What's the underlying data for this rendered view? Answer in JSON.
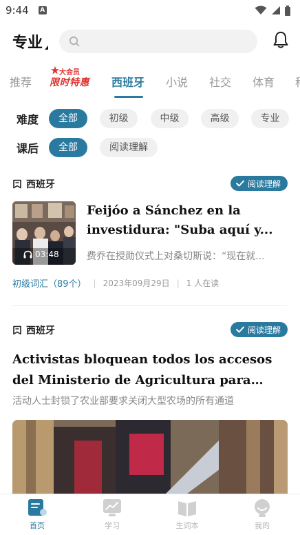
{
  "status_bar": {
    "time": "9:44",
    "notif": "A"
  },
  "header": {
    "level": "专业",
    "search_placeholder": ""
  },
  "tabs": {
    "items": [
      "推荐",
      "西班牙",
      "小说",
      "社交",
      "体育",
      "科"
    ],
    "active": "西班牙",
    "promo": {
      "top": "大会员",
      "main": "限时特惠"
    }
  },
  "filters": {
    "difficulty": {
      "label": "难度",
      "options": [
        "全部",
        "初级",
        "中级",
        "高级",
        "专业"
      ],
      "selected": "全部"
    },
    "after_class": {
      "label": "课后",
      "options": [
        "全部",
        "阅读理解"
      ],
      "selected": "全部"
    }
  },
  "articles": [
    {
      "category": "西班牙",
      "type": "阅读理解",
      "title": "Feijóo a Sánchez en la investidura: \"Suba aquí y...",
      "subtitle": "费乔在授勋仪式上对桑切斯说：“现在就...",
      "duration": "03:48",
      "vocab": "初级词汇（89个）",
      "date": "2023年09月29日",
      "readers": "1 人在读"
    },
    {
      "category": "西班牙",
      "type": "阅读理解",
      "title": "Activistas bloquean todos los accesos del Ministerio de Agricultura para exigir el...",
      "subtitle": "活动人士封锁了农业部要求关闭大型农场的所有通道"
    }
  ],
  "bottom_nav": {
    "items": [
      "首页",
      "学习",
      "生词本",
      "我的"
    ],
    "active": "首页"
  },
  "colors": {
    "accent": "#2a7aa0",
    "promo": "#e0322e"
  }
}
